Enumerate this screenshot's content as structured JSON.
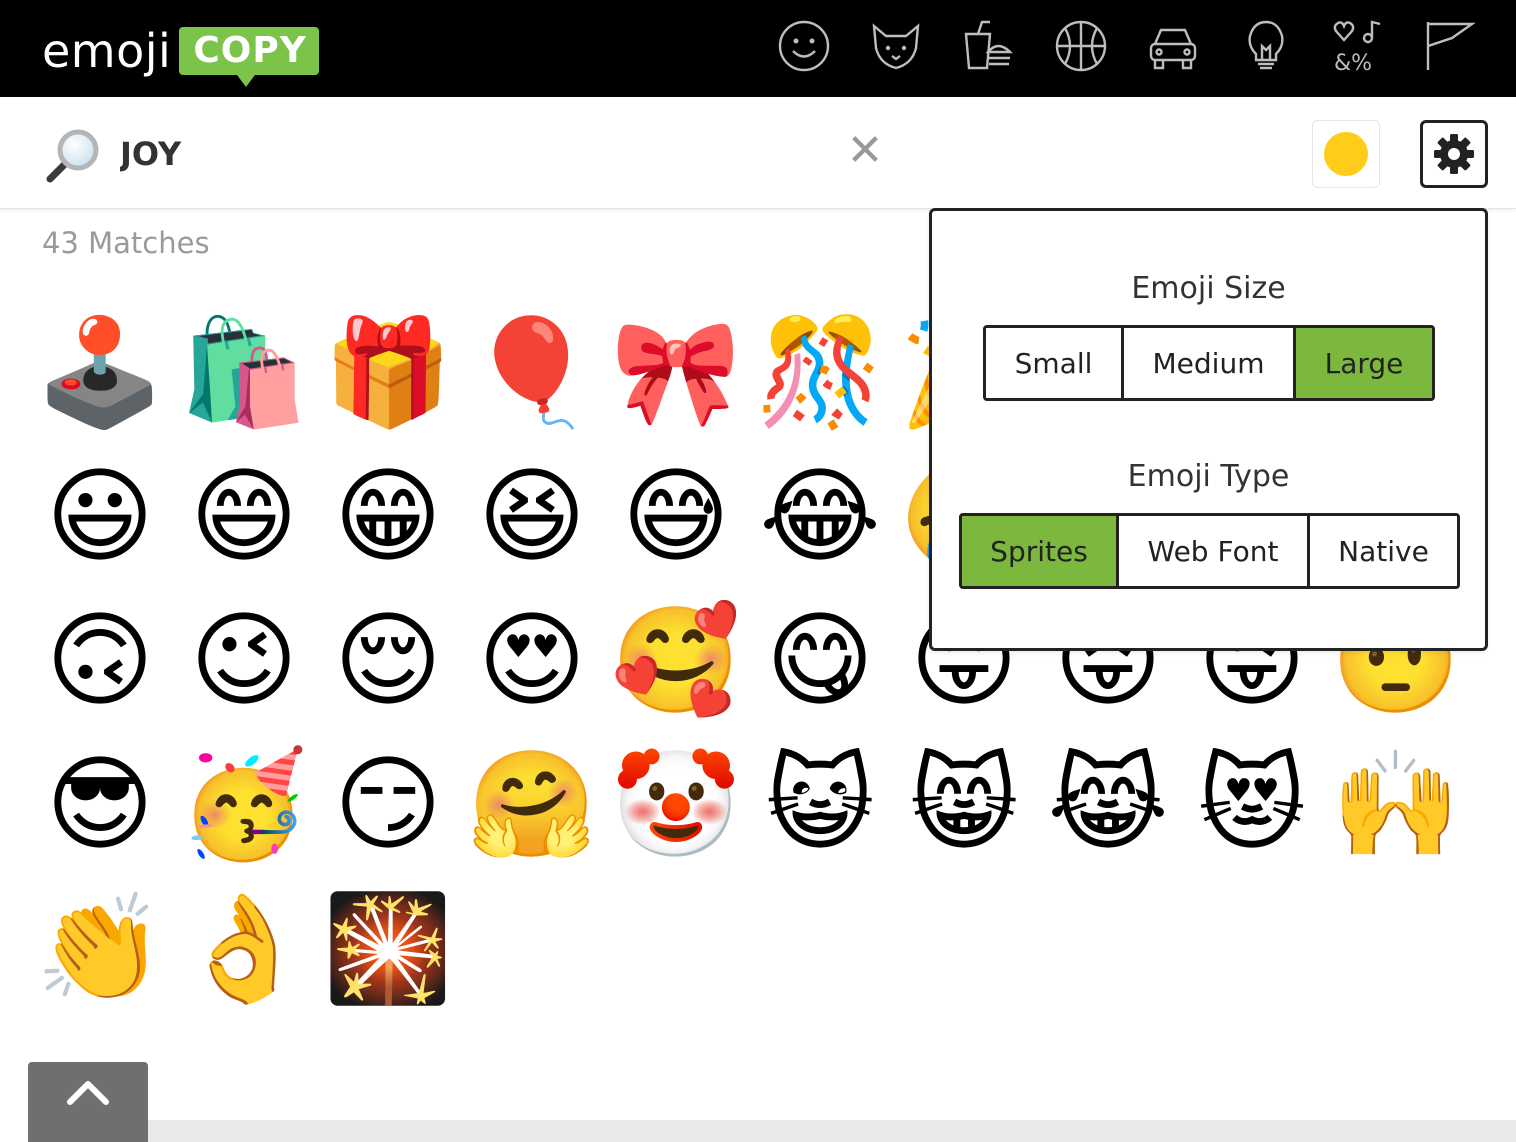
{
  "header": {
    "logo_word": "emoji",
    "logo_badge": "COPY",
    "brand_color": "#7cc34a",
    "categories": [
      {
        "name": "smileys-icon"
      },
      {
        "name": "animals-icon"
      },
      {
        "name": "food-icon"
      },
      {
        "name": "activities-icon"
      },
      {
        "name": "travel-icon"
      },
      {
        "name": "objects-icon"
      },
      {
        "name": "symbols-icon",
        "glyph": "&%"
      },
      {
        "name": "flags-icon"
      }
    ]
  },
  "search": {
    "value": "JOY",
    "clear_glyph": "✕",
    "tone_color": "#ffcc1a"
  },
  "results": {
    "matches_label": "43 Matches",
    "emojis": [
      "🕹️",
      "🛍️",
      "🎁",
      "🎈",
      "🎀",
      "🎊",
      "🎉",
      "",
      "",
      "",
      "😃",
      "😄",
      "😁",
      "😆",
      "😅",
      "😂",
      "🤣",
      "",
      "",
      "",
      "🙃",
      "😉",
      "😌",
      "😍",
      "🥰",
      "😋",
      "😛",
      "😝",
      "😜",
      "🤨",
      "😎",
      "🥳",
      "😏",
      "🤗",
      "🤡",
      "😺",
      "😸",
      "😹",
      "😻",
      "🙌",
      "👏",
      "👌",
      "🎇"
    ]
  },
  "settings_panel": {
    "size_title": "Emoji Size",
    "size_options": [
      "Small",
      "Medium",
      "Large"
    ],
    "size_selected": "Large",
    "type_title": "Emoji Type",
    "type_options": [
      "Sprites",
      "Web Font",
      "Native"
    ],
    "type_selected": "Sprites",
    "active_color": "#7cb83e"
  },
  "scroll_top": {
    "icon": "chevron-up-icon"
  }
}
